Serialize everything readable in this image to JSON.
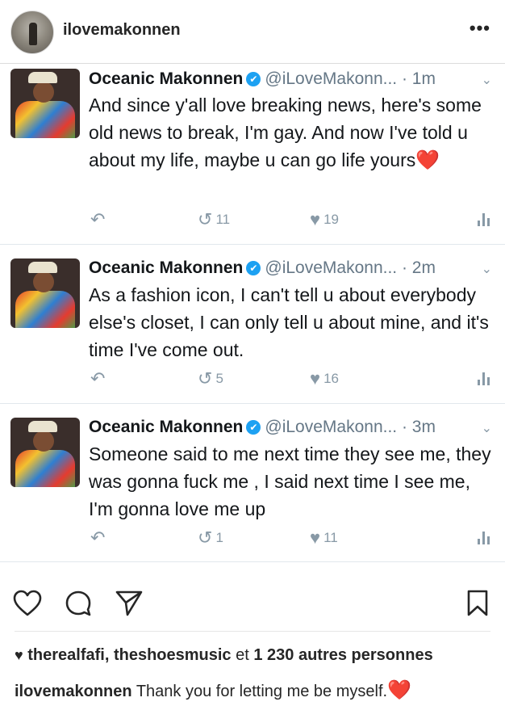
{
  "header": {
    "username": "ilovemakonnen",
    "more": "•••"
  },
  "tweets": [
    {
      "name": "Oceanic Makonnen",
      "verified_icon": "✔",
      "handle": "@iLoveMakonn...",
      "time": "· 1m",
      "text": "And since y'all love breaking news, here's some old news to break, I'm gay. And now I've told u about my life, maybe u can go life yours",
      "emoji": "❤️",
      "retweets": "11",
      "likes": "19"
    },
    {
      "name": "Oceanic Makonnen",
      "verified_icon": "✔",
      "handle": "@iLoveMakonn...",
      "time": "· 2m",
      "text": "As a fashion icon, I can't tell u about everybody else's closet, I can only tell u about mine, and it's time I've come out.",
      "retweets": "5",
      "likes": "16"
    },
    {
      "name": "Oceanic Makonnen",
      "verified_icon": "✔",
      "handle": "@iLoveMakonn...",
      "time": "· 3m",
      "text": "Someone said to me next time they see me, they was gonna fuck me , I said next time I see me, I'm gonna love me up",
      "retweets": "1",
      "likes": "11"
    }
  ],
  "post": {
    "likes_users": "therealfafi, theshoesmusic",
    "likes_joiner": " et ",
    "likes_count": "1 230 autres personnes",
    "caption_user": "ilovemakonnen",
    "caption_text": "Thank you for letting me be myself.",
    "caption_emoji": "❤️"
  },
  "colors": {
    "twitter_blue": "#1da1f2",
    "gray": "#8899a6",
    "heart": "#e0243b"
  },
  "icons": [
    "more-icon",
    "verified-icon",
    "chevron-down-icon",
    "reply-icon",
    "retweet-icon",
    "like-icon",
    "analytics-icon",
    "heart-icon",
    "comment-icon",
    "share-icon",
    "bookmark-icon"
  ]
}
